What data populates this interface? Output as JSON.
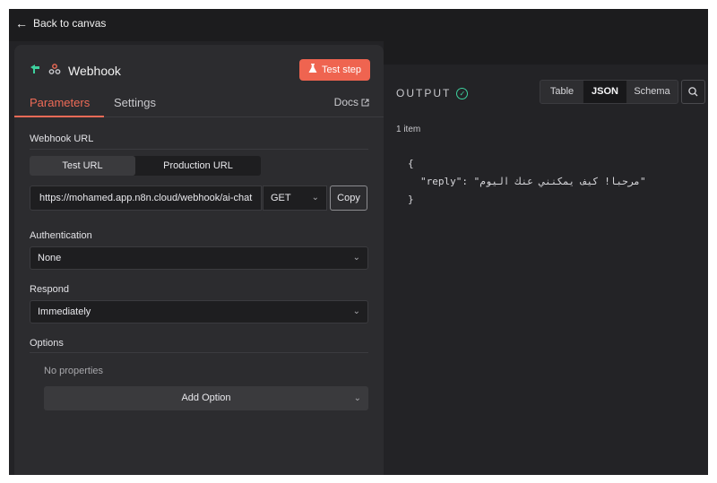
{
  "nav": {
    "back_label": "Back to canvas"
  },
  "node": {
    "title": "Webhook",
    "test_step_label": "Test step",
    "tabs": [
      "Parameters",
      "Settings"
    ],
    "docs_label": "Docs"
  },
  "params": {
    "webhook_url_label": "Webhook URL",
    "url_tabs": [
      "Test URL",
      "Production URL"
    ],
    "url_value": "https://mohamed.app.n8n.cloud/webhook/ai-chat",
    "method": "GET",
    "copy_label": "Copy",
    "authentication_label": "Authentication",
    "authentication_value": "None",
    "respond_label": "Respond",
    "respond_value": "Immediately",
    "options_label": "Options",
    "no_properties": "No properties",
    "add_option_label": "Add Option"
  },
  "output": {
    "title": "OUTPUT",
    "view_tabs": [
      "Table",
      "JSON",
      "Schema"
    ],
    "active_view": "JSON",
    "item_count": "1 item",
    "json_open": "{",
    "json_line": "\"reply\": \"مرحبا! كيف يمكنني عنك اليوم\"",
    "json_close": "}"
  },
  "colors": {
    "accent": "#ef6450",
    "success": "#3ed19e",
    "background": "#232326",
    "panel": "#2c2c2f"
  },
  "icons": [
    "arrow-left-icon",
    "lightning-pin-icon",
    "webhook-icon",
    "flask-icon",
    "external-link-icon",
    "chevron-down-icon",
    "check-circle-icon",
    "search-icon"
  ]
}
